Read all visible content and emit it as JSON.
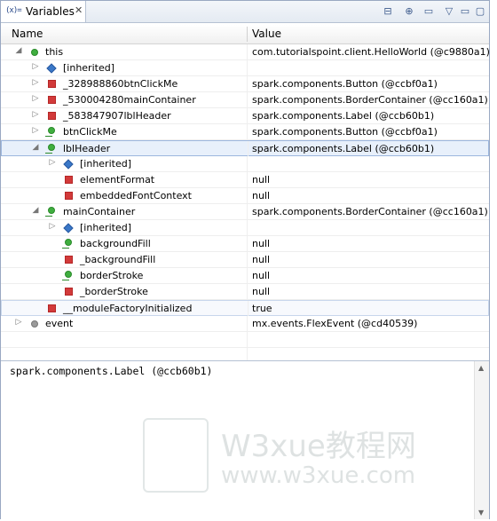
{
  "tab": {
    "icon": "(x)=",
    "title": "Variables",
    "close": "✕"
  },
  "toolbar": {
    "b1": "⊟",
    "b2": "⊕",
    "b3": "▭",
    "b4": "▽",
    "b5": "▭",
    "b6": "▢"
  },
  "columns": {
    "name": "Name",
    "value": "Value"
  },
  "rows": [
    {
      "name": "this",
      "value": "com.tutorialspoint.client.HelloWorld (@c9880a1)"
    },
    {
      "name": "[inherited]",
      "value": ""
    },
    {
      "name": "_328988860btnClickMe",
      "value": "spark.components.Button (@ccbf0a1)"
    },
    {
      "name": "_530004280mainContainer",
      "value": "spark.components.BorderContainer (@cc160a1)"
    },
    {
      "name": "_583847907lblHeader",
      "value": "spark.components.Label (@ccb60b1)"
    },
    {
      "name": "btnClickMe",
      "value": "spark.components.Button (@ccbf0a1)"
    },
    {
      "name": "lblHeader",
      "value": "spark.components.Label (@ccb60b1)"
    },
    {
      "name": "[inherited]",
      "value": ""
    },
    {
      "name": "elementFormat",
      "value": "null"
    },
    {
      "name": "embeddedFontContext",
      "value": "null"
    },
    {
      "name": "mainContainer",
      "value": "spark.components.BorderContainer (@cc160a1)"
    },
    {
      "name": "[inherited]",
      "value": ""
    },
    {
      "name": "backgroundFill",
      "value": "null"
    },
    {
      "name": "_backgroundFill",
      "value": "null"
    },
    {
      "name": "borderStroke",
      "value": "null"
    },
    {
      "name": "_borderStroke",
      "value": "null"
    },
    {
      "name": "__moduleFactoryInitialized",
      "value": "true"
    },
    {
      "name": "event",
      "value": "mx.events.FlexEvent (@cd40539)"
    }
  ],
  "detail": {
    "text": "spark.components.Label (@ccb60b1)"
  },
  "watermark": {
    "title": "W3xue教程网",
    "url": "www.w3xue.com"
  },
  "colors": {
    "accent": "#3fae3f",
    "field": "#d23a3a",
    "selection": "#e8f0fb"
  }
}
